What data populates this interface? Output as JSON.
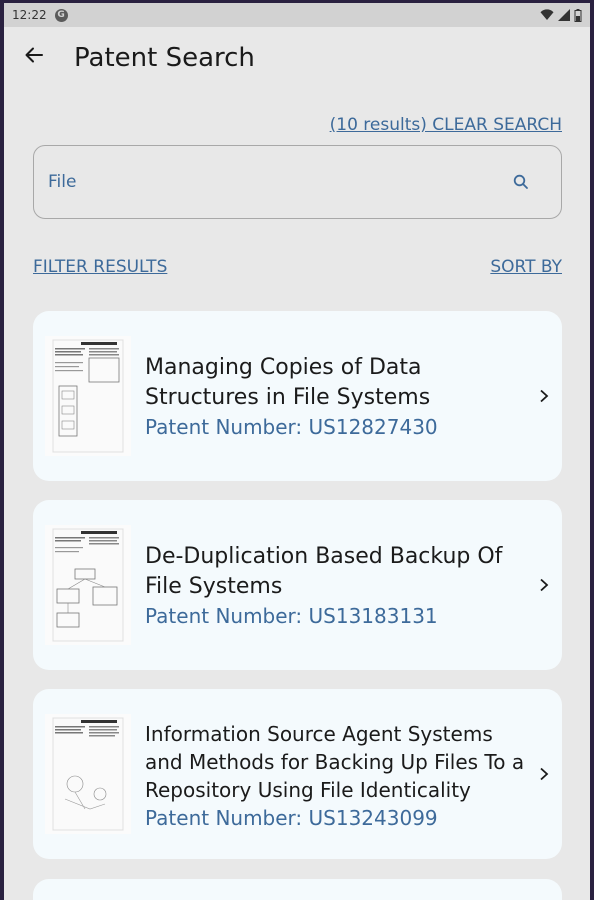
{
  "status_bar": {
    "time": "12:22",
    "app_icon": "G"
  },
  "header": {
    "title": "Patent Search"
  },
  "search": {
    "result_info": "(10 results) CLEAR SEARCH",
    "value": "File",
    "placeholder": ""
  },
  "actions": {
    "filter_label": "FILTER RESULTS",
    "sort_label": "SORT BY"
  },
  "results": [
    {
      "title": "Managing Copies of Data Structures in File Systems",
      "number": "Patent Number: US12827430"
    },
    {
      "title": "De-Duplication Based Backup Of File Systems",
      "number": "Patent Number: US13183131"
    },
    {
      "title": "Information Source Agent Systems and Methods for Backing Up Files To a Repository Using File Identicality",
      "number": "Patent Number: US13243099"
    }
  ],
  "colors": {
    "accent": "#3d6a9a",
    "background": "#e8e8e8",
    "card": "#f4fafd"
  }
}
